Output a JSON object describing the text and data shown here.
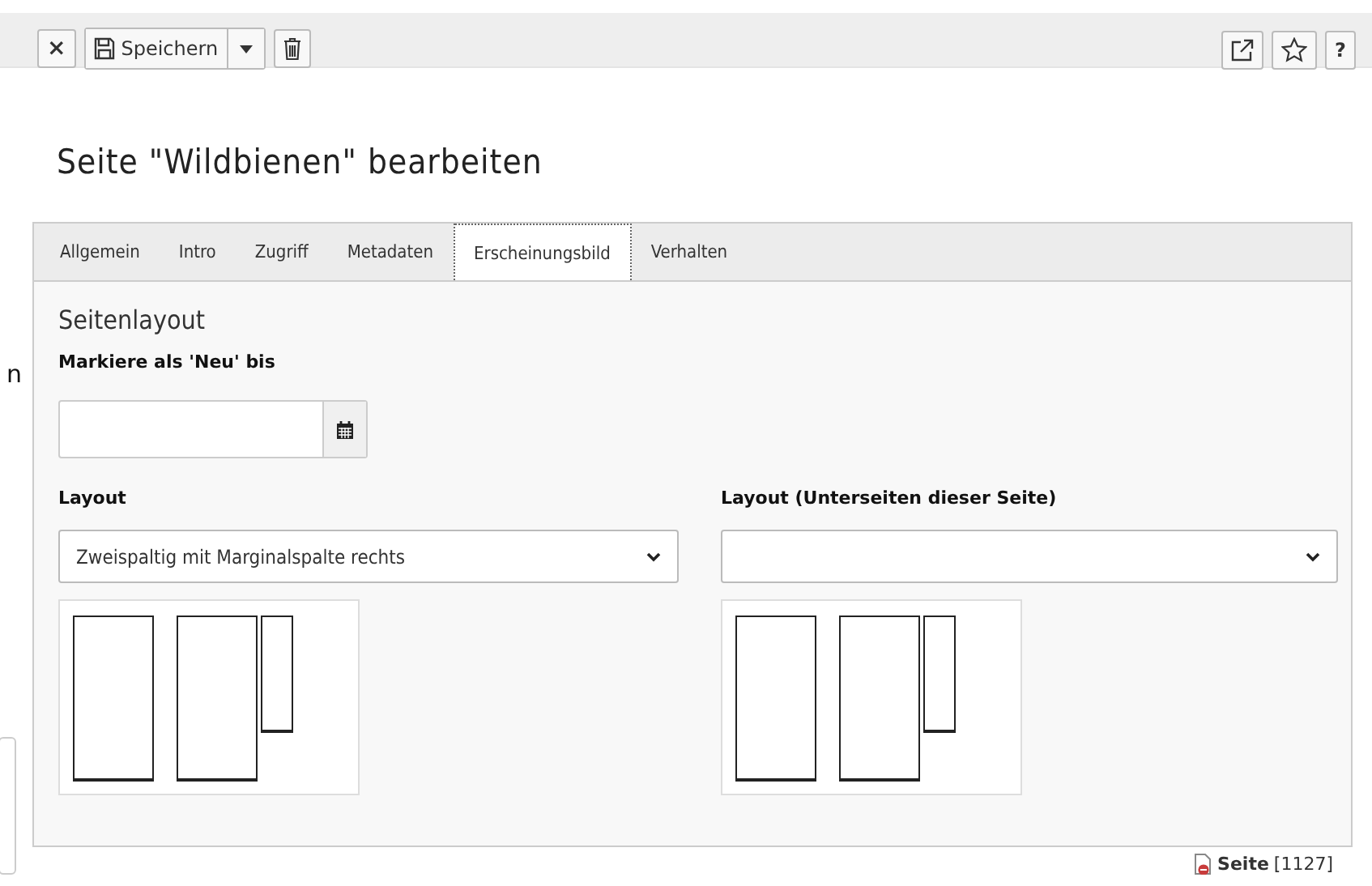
{
  "toolbar": {
    "close": "×",
    "save": "Speichern",
    "help": "?"
  },
  "edge_fragment": "n",
  "title": "Seite \"Wildbienen\" bearbeiten",
  "tabs": [
    {
      "label": "Allgemein",
      "selected": false
    },
    {
      "label": "Intro",
      "selected": false
    },
    {
      "label": "Zugriff",
      "selected": false
    },
    {
      "label": "Metadaten",
      "selected": false
    },
    {
      "label": "Erscheinungsbild",
      "selected": true
    },
    {
      "label": "Verhalten",
      "selected": false
    }
  ],
  "section": "Seitenlayout",
  "date_field": {
    "label": "Markiere als 'Neu' bis"
  },
  "layout_fields": [
    {
      "label": "Layout",
      "value": "Zweispaltig mit Marginalspalte rechts"
    },
    {
      "label": "Layout (Unterseiten dieser Seite)"
    }
  ],
  "footer": {
    "type": "Seite",
    "id": "[1127]"
  }
}
